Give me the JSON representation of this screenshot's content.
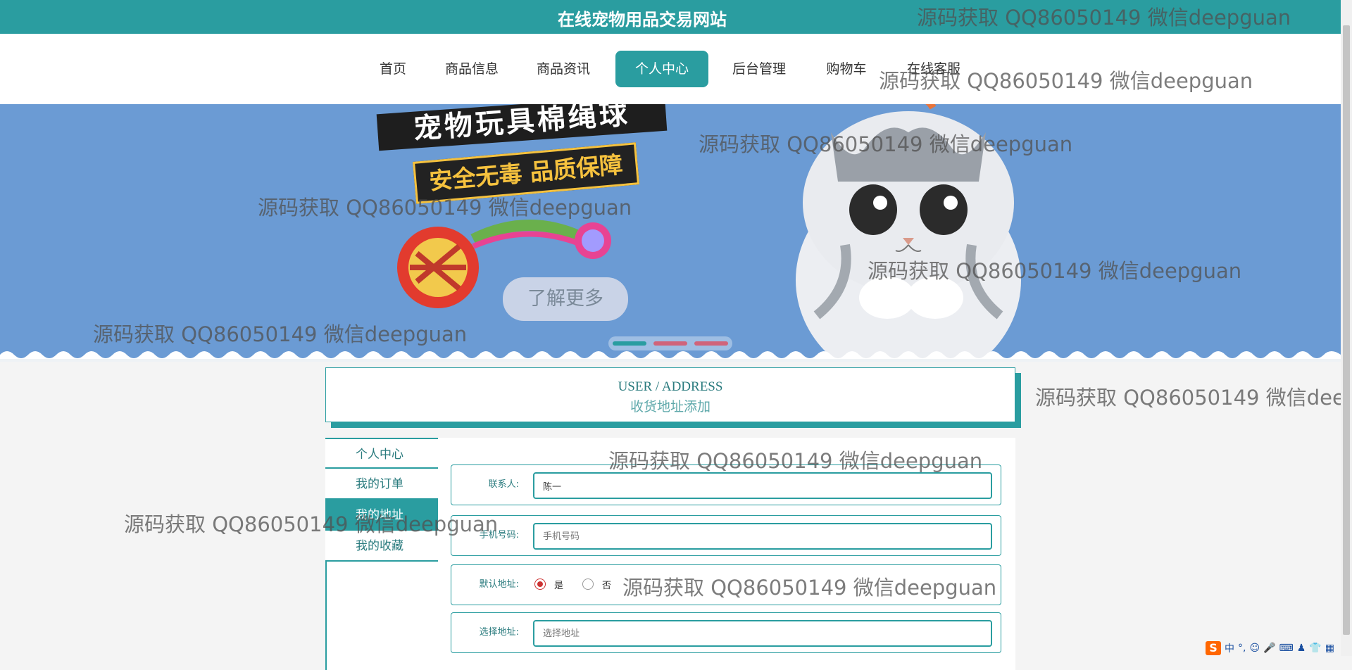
{
  "site": {
    "title": "在线宠物用品交易网站"
  },
  "nav": {
    "items": [
      {
        "label": "首页",
        "active": false
      },
      {
        "label": "商品信息",
        "active": false
      },
      {
        "label": "商品资讯",
        "active": false
      },
      {
        "label": "个人中心",
        "active": true
      },
      {
        "label": "后台管理",
        "active": false
      },
      {
        "label": "购物车",
        "active": false
      },
      {
        "label": "在线客服",
        "active": false
      }
    ]
  },
  "banner": {
    "headline": "宠物玩具棉绳球",
    "tagline": "安全无毒 品质保障",
    "button_label": "了解更多",
    "carousel": {
      "slide_count": 3,
      "active_index": 0
    }
  },
  "page_header": {
    "title_en": "USER / ADDRESS",
    "title_cn": "收货地址添加"
  },
  "sidebar": {
    "items": [
      {
        "label": "个人中心",
        "active": false
      },
      {
        "label": "我的订单",
        "active": false
      },
      {
        "label": "我的地址",
        "active": true
      },
      {
        "label": "我的收藏",
        "active": false
      }
    ]
  },
  "form": {
    "contact": {
      "label": "联系人:",
      "value": "陈一",
      "placeholder": ""
    },
    "phone": {
      "label": "手机号码:",
      "value": "",
      "placeholder": "手机号码"
    },
    "default_address": {
      "label": "默认地址:",
      "options": [
        "是",
        "否"
      ],
      "selected": "是"
    },
    "address": {
      "label": "选择地址:",
      "value": "",
      "placeholder": "选择地址"
    }
  },
  "watermark": {
    "text": "源码获取 QQ86050149 微信deepguan"
  },
  "ime": {
    "logo": "S",
    "mode": "中"
  },
  "colors": {
    "primary": "#2a9da0",
    "banner_bg": "#6b9bd4"
  }
}
